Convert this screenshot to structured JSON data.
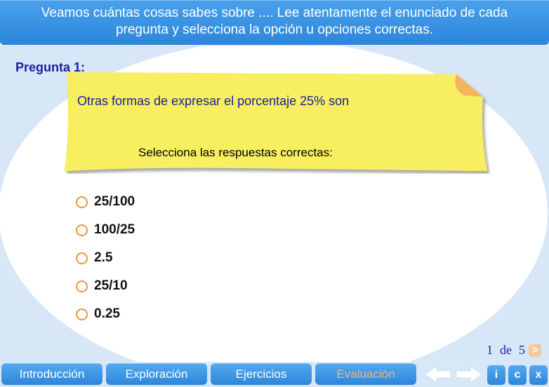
{
  "header": {
    "line1": "Veamos cuántas cosas sabes sobre .... Lee atentamente el enunciado de cada",
    "line2": "pregunta y selecciona la opción u opciones correctas."
  },
  "question": {
    "label": "Pregunta 1:",
    "text": "Otras formas de expresar el porcentaje 25% son",
    "instruction": "Selecciona las respuestas correctas:"
  },
  "options": [
    {
      "label": "25/100",
      "selected": false
    },
    {
      "label": "100/25",
      "selected": false
    },
    {
      "label": "2.5",
      "selected": false
    },
    {
      "label": "25/10",
      "selected": false
    },
    {
      "label": "0.25",
      "selected": false
    }
  ],
  "pager": {
    "current": "1",
    "of": "de",
    "total": "5",
    "next": ">"
  },
  "tabs": [
    {
      "label": "Introducción",
      "active": false
    },
    {
      "label": "Exploración",
      "active": false
    },
    {
      "label": "Ejercicios",
      "active": false
    },
    {
      "label": "Evaluación",
      "active": true
    }
  ],
  "buttons": {
    "info": "i",
    "credits": "c",
    "exit": "x"
  },
  "icons": {
    "back": "arrow-left-icon",
    "forward": "arrow-right-icon"
  },
  "colors": {
    "accent_blue": "#2c86dc",
    "note_yellow": "#f7ef5e",
    "radio_orange": "#e79a3f",
    "text_navy": "#1a1f9e",
    "active_tab_text": "#f3b486"
  }
}
